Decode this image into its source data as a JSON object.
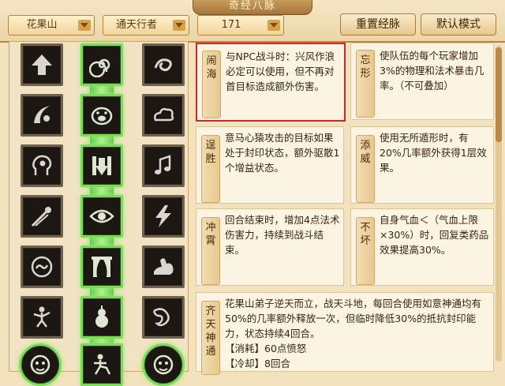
{
  "window": {
    "title": "奇经八脉"
  },
  "toolbar": {
    "school_dropdown": "花果山",
    "path_dropdown": "通天行者",
    "points_dropdown": "171",
    "reset_button": "重置经脉",
    "default_button": "默认模式"
  },
  "skill_grid": {
    "icons": [
      "up-arrow-icon",
      "spiral-icon",
      "swirl-icon",
      "crescent-blade-icon",
      "pig-face-icon",
      "cloud-icon",
      "head-profile-icon",
      "down-arrow-icon",
      "music-note-icon",
      "comet-icon",
      "eye-icon",
      "lightning-icon",
      "circle-swirl-icon",
      "curtain-icon",
      "strong-arm-icon",
      "dancing-figure-icon",
      "gourd-icon",
      "dragon-icon",
      "monkey-face-icon",
      "rider-icon",
      "monkey-face-icon"
    ]
  },
  "talents": [
    {
      "name": "闹海",
      "text": "与NPC战斗时：兴风作浪必定可以使用，但不再对首目标造成额外伤害。"
    },
    {
      "name": "忘形",
      "text": "使队伍的每个玩家增加3%的物理和法术暴击几率。（不可叠加）"
    },
    {
      "name": "逞胜",
      "text": "意马心猿攻击的目标如果处于封印状态，额外驱散1个增益状态。"
    },
    {
      "name": "添威",
      "text": "使用无所遁形时，有20%几率额外获得1层效果。"
    },
    {
      "name": "冲霄",
      "text": "回合结束时，增加4点法术伤害力，持续到战斗结束。"
    },
    {
      "name": "不坏",
      "text": "自身气血＜（气血上限×30%）时，回复类药品效果提高30%。"
    },
    {
      "name": "齐天神通",
      "text": "花果山弟子逆天而立，战天斗地，每回合使用如意神通均有50%的几率额外释放一次，但临时降低30%的抵抗封印能力，状态持续4回合。",
      "cost_label": "【消耗】",
      "cost_value": "60点愤怒",
      "cooldown_label": "【冷却】",
      "cooldown_value": "8回合"
    }
  ]
}
